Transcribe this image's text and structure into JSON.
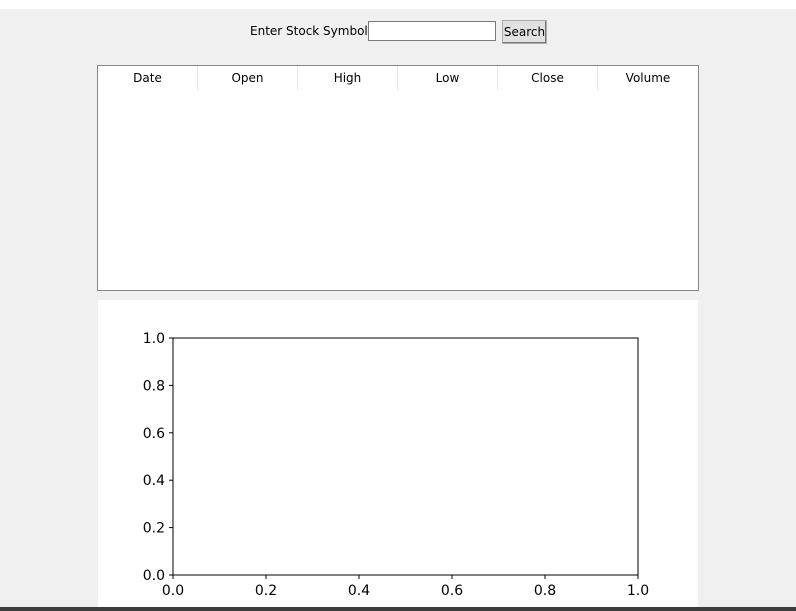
{
  "search": {
    "label": "Enter Stock Symbol:",
    "value": "",
    "placeholder": "",
    "button_label": "Search"
  },
  "table": {
    "columns": [
      "Date",
      "Open",
      "High",
      "Low",
      "Close",
      "Volume"
    ],
    "rows": []
  },
  "chart_data": {
    "type": "line",
    "title": "",
    "xlabel": "",
    "ylabel": "",
    "xlim": [
      0.0,
      1.0
    ],
    "ylim": [
      0.0,
      1.0
    ],
    "x_ticks": [
      "0.0",
      "0.2",
      "0.4",
      "0.6",
      "0.8",
      "1.0"
    ],
    "y_ticks": [
      "0.0",
      "0.2",
      "0.4",
      "0.6",
      "0.8",
      "1.0"
    ],
    "grid": false,
    "series": []
  }
}
